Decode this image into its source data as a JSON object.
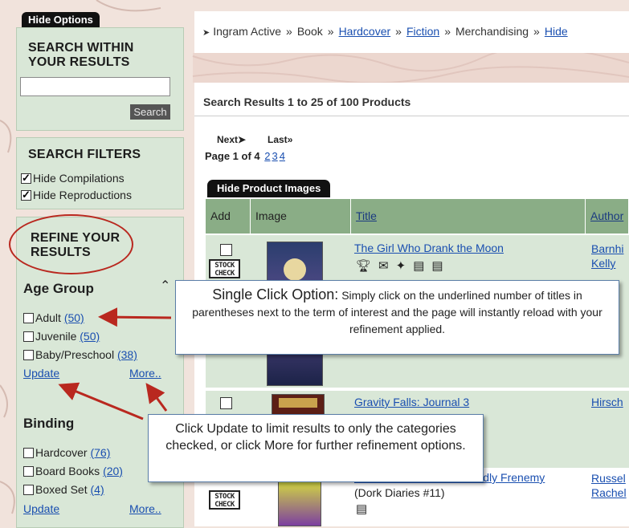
{
  "sidebar": {
    "hide_options_label": "Hide Options",
    "search_within": {
      "title_line1": "SEARCH WITHIN",
      "title_line2": "YOUR RESULTS",
      "input_value": "",
      "button_label": "Search"
    },
    "search_filters": {
      "title": "SEARCH FILTERS",
      "items": [
        {
          "label": "Hide Compilations",
          "checked": true
        },
        {
          "label": "Hide Reproductions",
          "checked": true
        }
      ]
    },
    "refine": {
      "title_line1": "REFINE YOUR",
      "title_line2": "RESULTS",
      "age_group": {
        "title": "Age Group",
        "items": [
          {
            "label": "Adult",
            "count": "(50)"
          },
          {
            "label": "Juvenile",
            "count": "(50)"
          },
          {
            "label": "Baby/Preschool",
            "count": "(38)"
          }
        ],
        "update_label": "Update",
        "more_label": "More.."
      },
      "binding": {
        "title": "Binding",
        "items": [
          {
            "label": "Hardcover",
            "count": "(76)"
          },
          {
            "label": "Board Books",
            "count": "(20)"
          },
          {
            "label": "Boxed Set",
            "count": "(4)"
          }
        ],
        "update_label": "Update",
        "more_label": "More.."
      }
    }
  },
  "breadcrumb": {
    "items": [
      "Ingram Active",
      "Book",
      "Hardcover",
      "Fiction",
      "Merchandising",
      "Hide"
    ],
    "links": [
      false,
      false,
      true,
      true,
      false,
      true
    ],
    "separator": "»"
  },
  "results": {
    "heading": "Search Results 1 to 25 of 100 Products",
    "next_label": "Next",
    "last_label": "Last",
    "page_text": "Page 1 of 4",
    "page_links": [
      "2",
      "3",
      "4"
    ],
    "hide_images_label": "Hide Product Images",
    "columns": [
      "Add",
      "Image",
      "Title",
      "Author"
    ],
    "stock_check_label": "STOCK CHECK",
    "products": [
      {
        "title": "The Girl Who Drank the Moon",
        "author_line1": "Barnhi",
        "author_line2": "Kelly",
        "subtitle": ""
      },
      {
        "title": "Gravity Falls: Journal 3",
        "author_line1": "Hirsch",
        "author_line2": "",
        "subtitle": ""
      },
      {
        "title": "Tales from a Not-So-Friendly Frenemy",
        "author_line1": "Russel",
        "author_line2": "Rachel",
        "subtitle": "(Dork Diaries #11)"
      }
    ]
  },
  "callouts": {
    "single_click_title": "Single Click Option:",
    "single_click_body": "Simply click on the underlined number of titles in parentheses next to the term of interest and the page will instantly reload with your refinement applied.",
    "update_more_text": "Click Update to limit results to only the categories checked, or click More for further refinement options."
  },
  "colors": {
    "sidebar_box": "#d9e7d7",
    "table_header": "#8aad86",
    "annotation_red": "#b9281f",
    "link_blue": "#1a4fb0"
  }
}
